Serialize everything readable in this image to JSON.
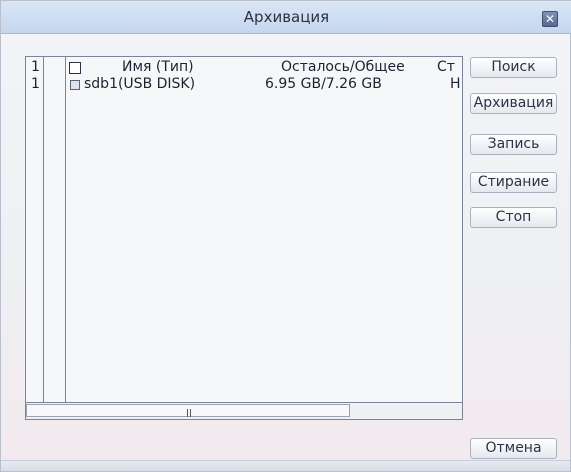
{
  "window": {
    "title": "Архивация",
    "close_glyph": "✕"
  },
  "table": {
    "header": {
      "index": "1",
      "name": "Имя (Тип)",
      "space": "Осталось/Общее",
      "status": "Ст"
    },
    "rows": [
      {
        "index": "1",
        "checked": true,
        "name": "sdb1(USB DISK)",
        "space": "6.95 GB/7.26 GB",
        "status": "Н"
      }
    ]
  },
  "buttons": {
    "search": "Поиск",
    "archive": "Архивация",
    "record": "Запись",
    "erase": "Стирание",
    "stop": "Стоп",
    "cancel": "Отмена"
  }
}
